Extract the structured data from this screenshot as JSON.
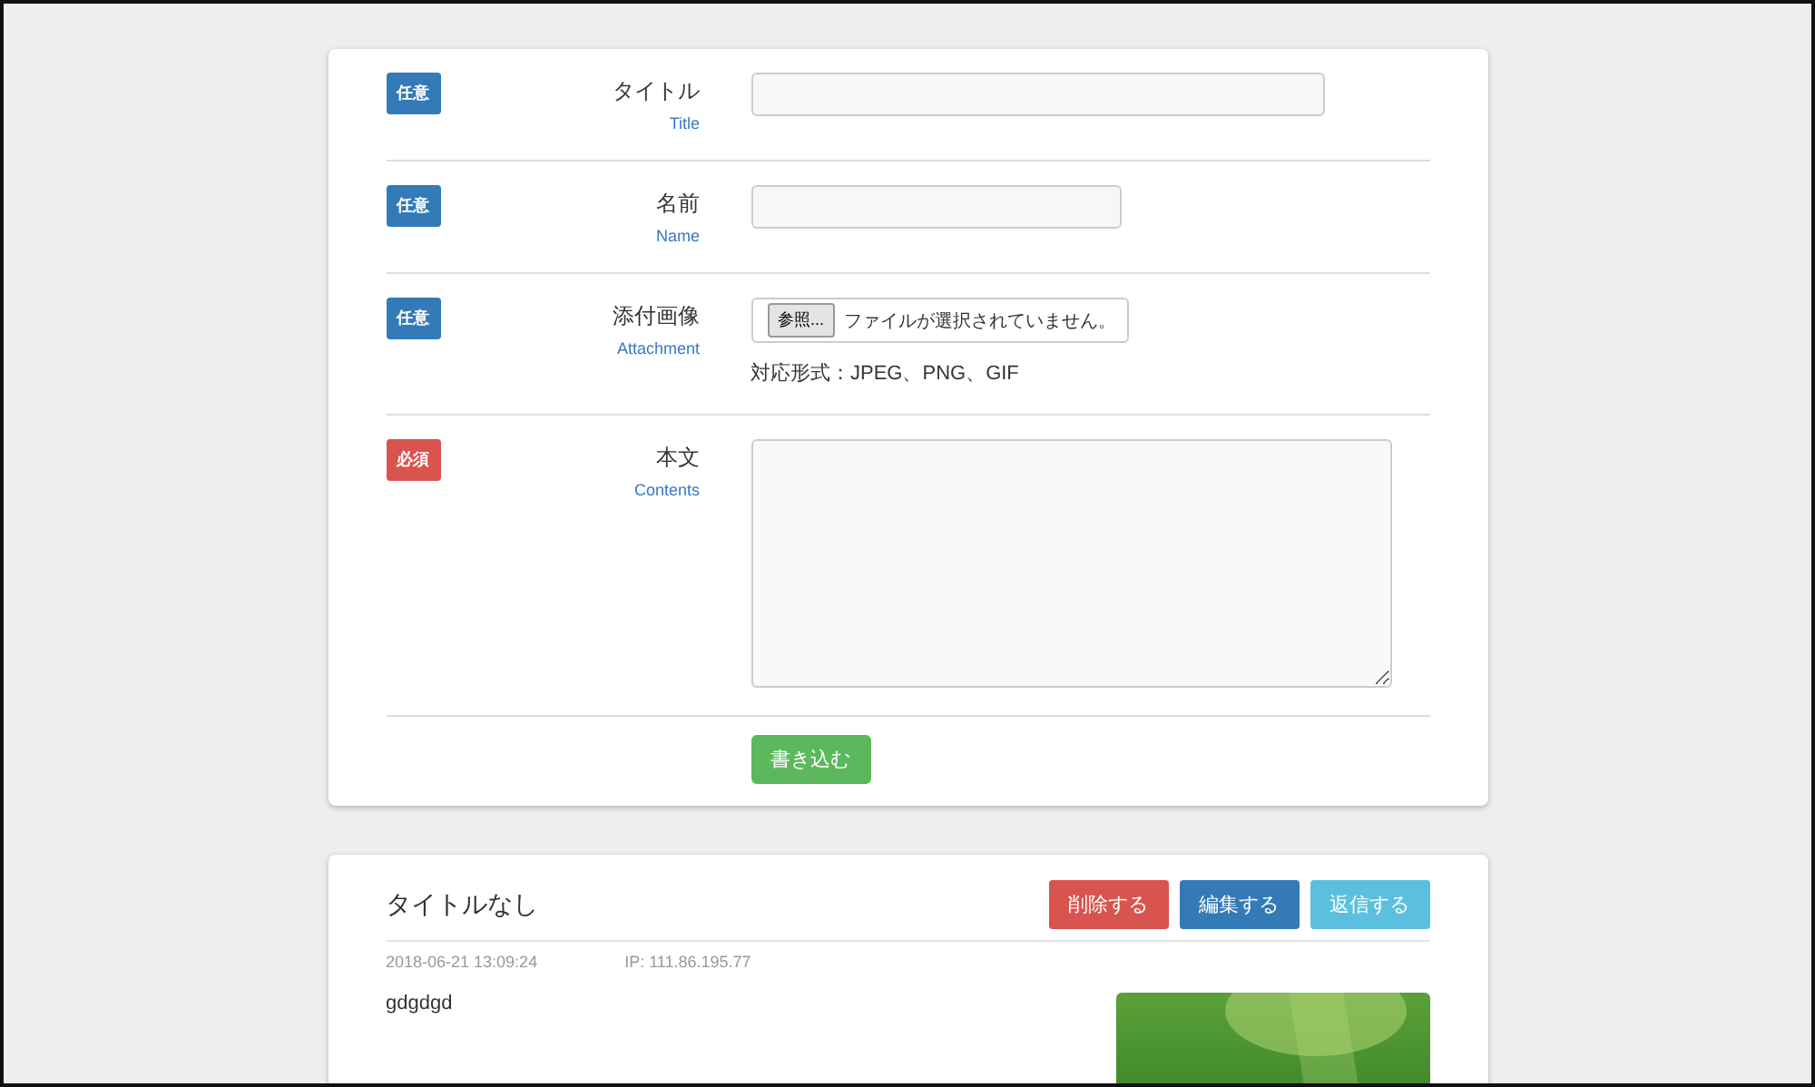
{
  "form": {
    "rows": [
      {
        "badge": "任意",
        "required": false,
        "label": "タイトル",
        "sublabel": "Title",
        "field": {
          "kind": "wide"
        }
      },
      {
        "badge": "任意",
        "required": false,
        "label": "名前",
        "sublabel": "Name",
        "field": {
          "kind": "narrow"
        }
      },
      {
        "badge": "任意",
        "required": false,
        "label": "添付画像",
        "sublabel": "Attachment",
        "field": {
          "kind": "file",
          "button": "参照...",
          "status": "ファイルが選択されていません。",
          "note": "対応形式：JPEG、PNG、GIF"
        }
      },
      {
        "badge": "必須",
        "required": true,
        "label": "本文",
        "sublabel": "Contents",
        "field": {
          "kind": "textarea"
        }
      }
    ],
    "submit": "書き込む"
  },
  "post": {
    "title": "タイトルなし",
    "buttons": [
      {
        "label": "削除する",
        "kind": "danger"
      },
      {
        "label": "編集する",
        "kind": "primary"
      },
      {
        "label": "返信する",
        "kind": "info"
      }
    ],
    "date": "2018-06-21 13:09:24",
    "ip": "IP: 111.86.195.77",
    "body": "gdgdgd"
  }
}
